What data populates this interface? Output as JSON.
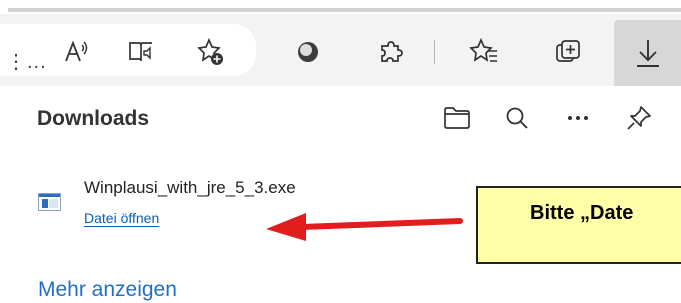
{
  "toolbar": {
    "overflow_text": "⋮...",
    "icons": [
      "read-aloud-icon",
      "immersive-reader-icon",
      "add-favorite-icon",
      "extension-circle-icon",
      "extensions-icon",
      "favorites-icon",
      "collections-icon",
      "downloads-icon"
    ]
  },
  "downloads": {
    "title": "Downloads",
    "header_icons": [
      "open-folder-icon",
      "search-icon",
      "more-options-icon",
      "pin-icon"
    ],
    "items": [
      {
        "file_name": "Winplausi_with_jre_5_3.exe",
        "action_label": "Datei öffnen"
      }
    ],
    "more_label": "Mehr anzeigen"
  },
  "annotation": {
    "callout_text": "Bitte „Date",
    "colors": {
      "arrow": "#e21d1d",
      "callout_bg": "#ffffa8"
    }
  }
}
